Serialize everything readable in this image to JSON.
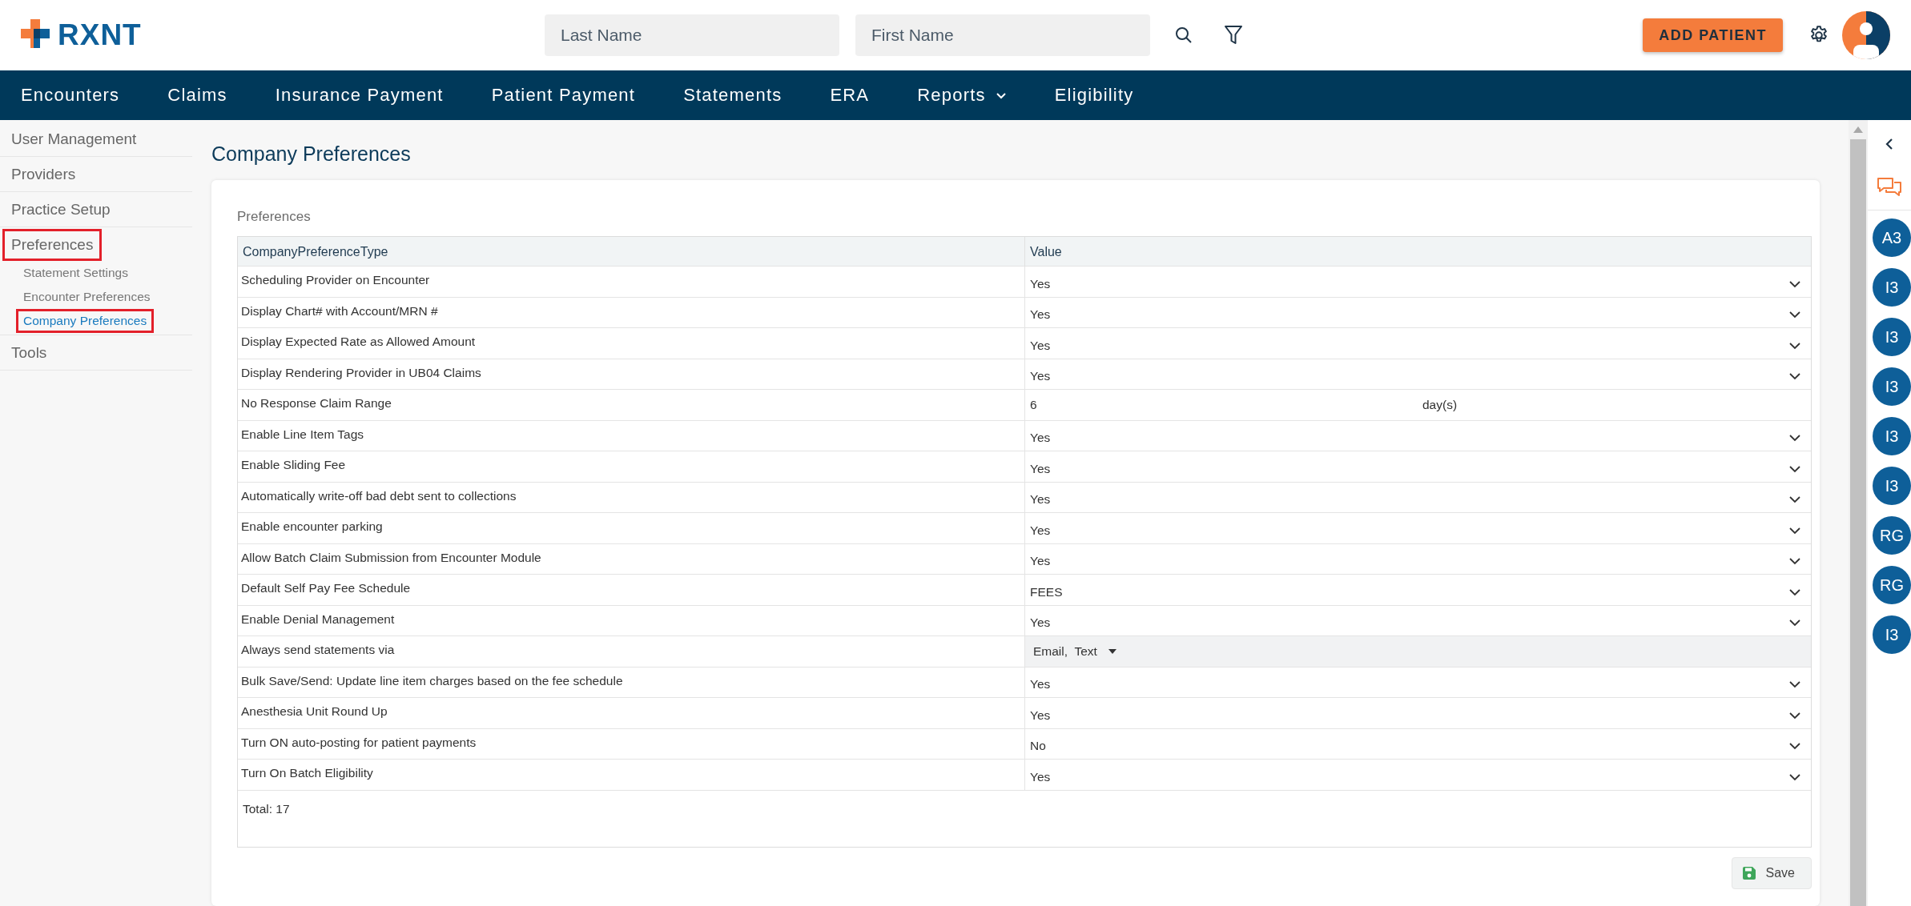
{
  "header": {
    "logo_text": "RXNT",
    "search_fields": [
      {
        "placeholder": "Last Name"
      },
      {
        "placeholder": "First Name"
      }
    ],
    "add_button": "ADD PATIENT"
  },
  "nav": [
    {
      "label": "Encounters",
      "has_menu": false
    },
    {
      "label": "Claims",
      "has_menu": false
    },
    {
      "label": "Insurance Payment",
      "has_menu": false
    },
    {
      "label": "Patient Payment",
      "has_menu": false
    },
    {
      "label": "Statements",
      "has_menu": false
    },
    {
      "label": "ERA",
      "has_menu": false
    },
    {
      "label": "Reports",
      "has_menu": true
    },
    {
      "label": "Eligibility",
      "has_menu": false
    }
  ],
  "sidebar": {
    "items": [
      {
        "label": "User Management",
        "outlined": false,
        "selected": false
      },
      {
        "label": "Providers",
        "outlined": false,
        "selected": false
      },
      {
        "label": "Practice Setup",
        "outlined": false,
        "selected": false
      },
      {
        "label": "Preferences",
        "outlined": true,
        "selected": false,
        "children": [
          {
            "label": "Statement Settings",
            "outlined": false,
            "selected": false
          },
          {
            "label": "Encounter Preferences",
            "outlined": false,
            "selected": false
          },
          {
            "label": "Company Preferences",
            "outlined": true,
            "selected": true
          }
        ]
      },
      {
        "label": "Tools",
        "outlined": false,
        "selected": false
      }
    ]
  },
  "page_title": "Company Preferences",
  "section_label": "Preferences",
  "table": {
    "columns": [
      "CompanyPreferenceType",
      "Value"
    ],
    "rows": [
      {
        "type": "Scheduling Provider on Encounter",
        "kind": "select",
        "value": "Yes"
      },
      {
        "type": "Display Chart# with Account/MRN #",
        "kind": "select",
        "value": "Yes"
      },
      {
        "type": "Display Expected Rate as Allowed Amount",
        "kind": "select",
        "value": "Yes"
      },
      {
        "type": "Display Rendering Provider in UB04 Claims",
        "kind": "select",
        "value": "Yes"
      },
      {
        "type": "No Response Claim Range",
        "kind": "number",
        "value": "6",
        "unit": "day(s)"
      },
      {
        "type": "Enable Line Item Tags",
        "kind": "select",
        "value": "Yes"
      },
      {
        "type": "Enable Sliding Fee",
        "kind": "select",
        "value": "Yes"
      },
      {
        "type": "Automatically write-off bad debt sent to collections",
        "kind": "select",
        "value": "Yes"
      },
      {
        "type": "Enable encounter parking",
        "kind": "select",
        "value": "Yes"
      },
      {
        "type": "Allow Batch Claim Submission from Encounter Module",
        "kind": "select",
        "value": "Yes"
      },
      {
        "type": "Default Self Pay Fee Schedule",
        "kind": "select",
        "value": "FEES"
      },
      {
        "type": "Enable Denial Management",
        "kind": "select",
        "value": "Yes"
      },
      {
        "type": "Always send statements via",
        "kind": "multiselect",
        "value": "Email,  Text"
      },
      {
        "type": "Bulk Save/Send: Update line item charges based on the fee schedule",
        "kind": "select",
        "value": "Yes"
      },
      {
        "type": "Anesthesia Unit Round Up",
        "kind": "select",
        "value": "Yes"
      },
      {
        "type": "Turn ON auto-posting for patient payments",
        "kind": "select",
        "value": "No"
      },
      {
        "type": "Turn On Batch Eligibility",
        "kind": "select",
        "value": "Yes"
      }
    ],
    "total": "Total: 17"
  },
  "save_button": "Save",
  "right_rail": {
    "badges": [
      "A3",
      "I3",
      "I3",
      "I3",
      "I3",
      "I3",
      "RG",
      "RG",
      "I3"
    ]
  }
}
